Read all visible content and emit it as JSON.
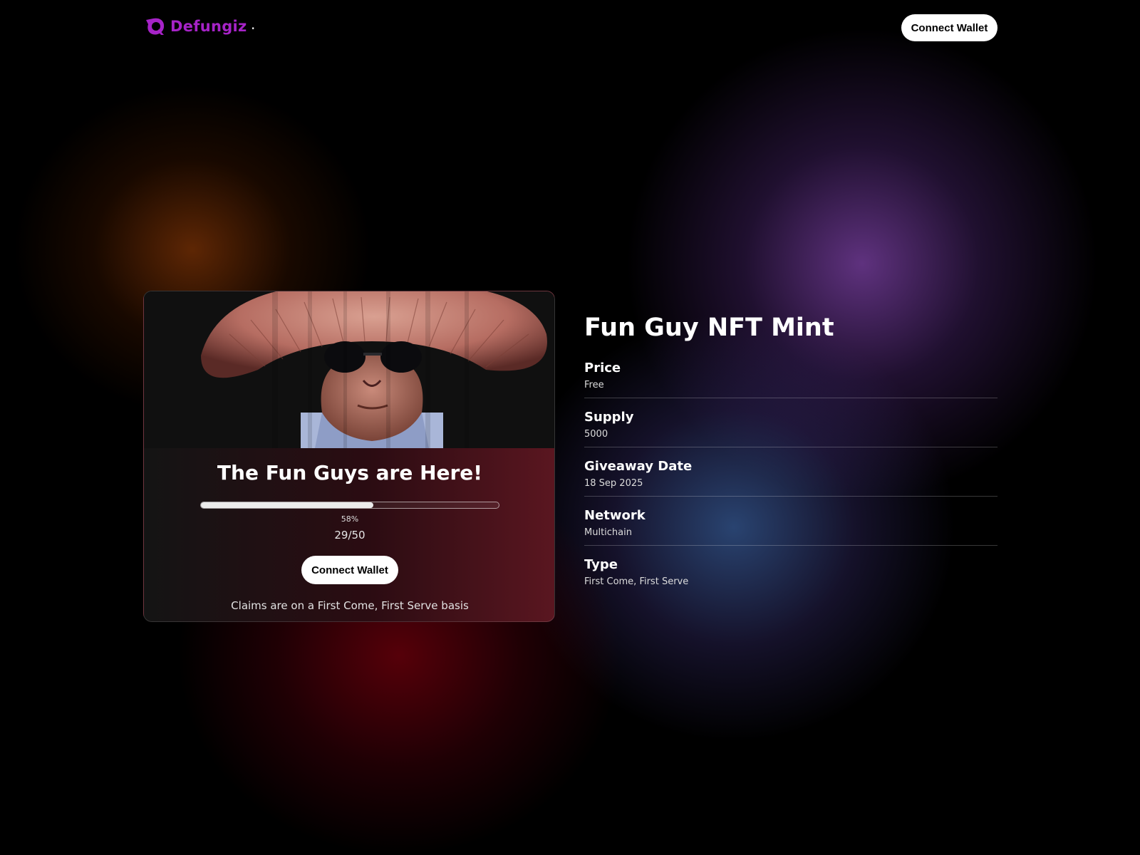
{
  "brand": {
    "name": "Defungiz",
    "separator": ".",
    "color": "#a623c7"
  },
  "header": {
    "connect_wallet_label": "Connect Wallet"
  },
  "card": {
    "title": "The Fun Guys are Here!",
    "progress": {
      "fraction": 0.58,
      "percent_label": "58%",
      "claimed": 29,
      "total": 50,
      "count_label": "29/50"
    },
    "connect_wallet_label": "Connect Wallet",
    "note": "Claims are on a First Come, First Serve basis"
  },
  "details": {
    "title": "Fun Guy NFT Mint",
    "rows": [
      {
        "label": "Price",
        "value": "Free"
      },
      {
        "label": "Supply",
        "value": "5000"
      },
      {
        "label": "Giveaway Date",
        "value": "18 Sep 2025"
      },
      {
        "label": "Network",
        "value": "Multichain"
      },
      {
        "label": "Type",
        "value": "First Come, First Serve"
      }
    ]
  },
  "icons": {
    "logo": "defungiz-logo-icon",
    "hero": "mushroom-character-image"
  }
}
